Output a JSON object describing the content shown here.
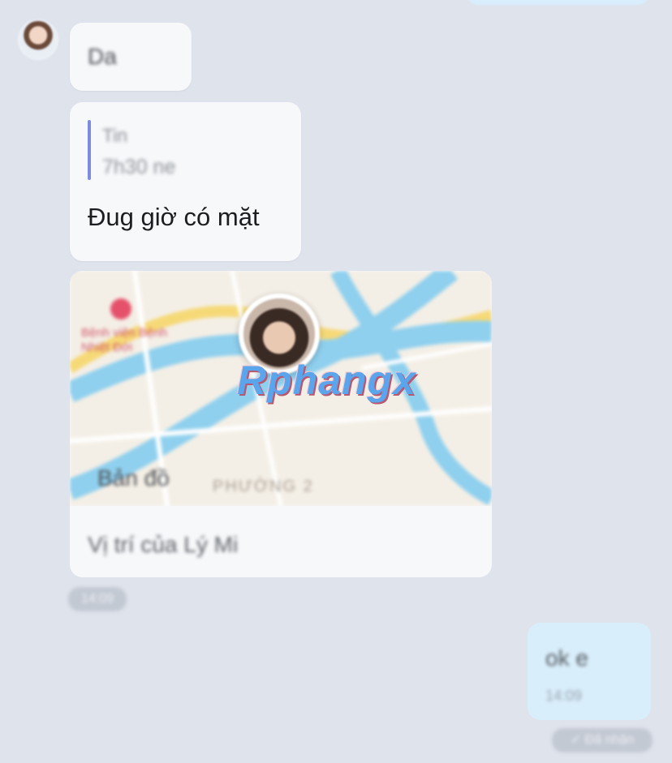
{
  "chat": {
    "incoming": {
      "text_message": "Da",
      "reply_message": {
        "quoted_sender": "Tin",
        "quoted_text": "7h30 ne",
        "text": "Đug giờ có mặt"
      },
      "location": {
        "maps_logo": "Bản đồ",
        "district_label": "PHƯỜNG 2",
        "poi_label": "Bệnh viện Bệnh Nhiệt Đới",
        "caption": "Vị trí của Lý Mi",
        "time": "14:09"
      }
    },
    "outgoing": {
      "text": "ok e",
      "time": "14:09",
      "status": "✓ Đã nhận"
    }
  },
  "watermark": "Rphangx",
  "colors": {
    "background": "#dfe3ec",
    "incoming_bubble": "#f7f8fa",
    "outgoing_bubble": "#d9eefb",
    "quote_bar": "#7d8be0",
    "water": "#8fd0ee"
  }
}
